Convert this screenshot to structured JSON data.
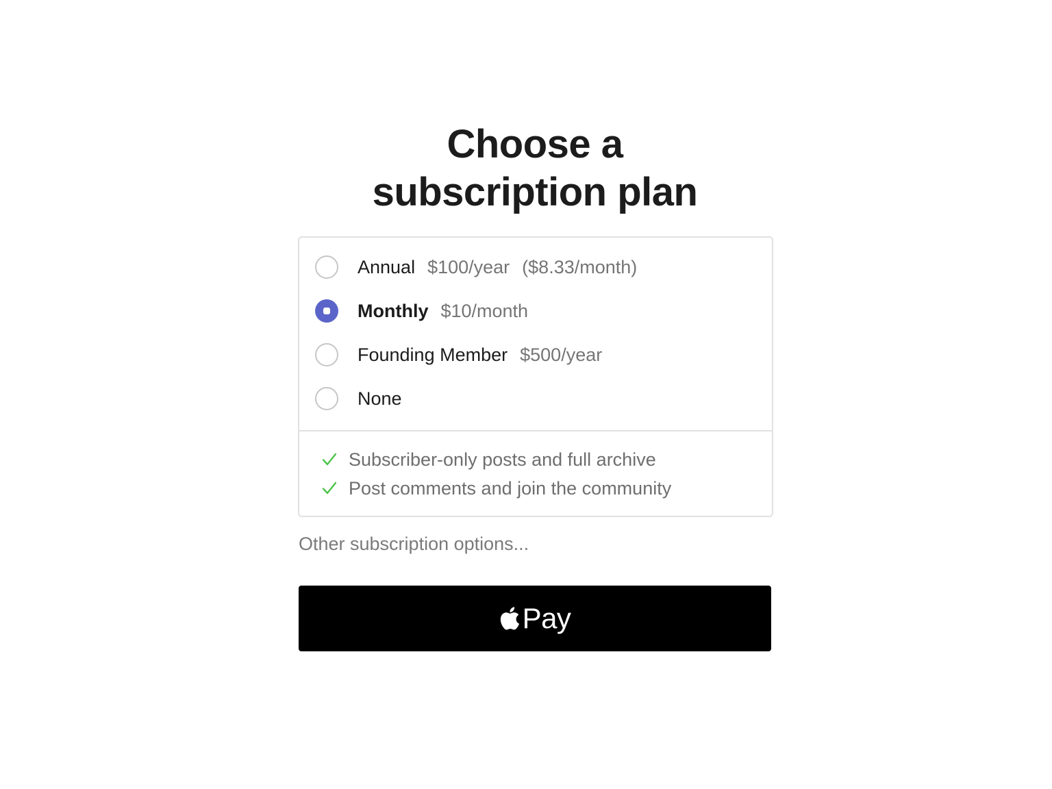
{
  "title": {
    "line1": "Choose a",
    "line2": "subscription plan"
  },
  "plans": [
    {
      "name": "Annual",
      "price": "$100/year",
      "extra": "($8.33/month)",
      "selected": false
    },
    {
      "name": "Monthly",
      "price": "$10/month",
      "extra": "",
      "selected": true
    },
    {
      "name": "Founding Member",
      "price": "$500/year",
      "extra": "",
      "selected": false
    },
    {
      "name": "None",
      "price": "",
      "extra": "",
      "selected": false
    }
  ],
  "benefits": [
    {
      "icon": "checkmark-icon",
      "text": "Subscriber-only posts and full archive"
    },
    {
      "icon": "checkmark-icon",
      "text": "Post comments and join the community"
    }
  ],
  "other_options_link": "Other subscription options...",
  "apple_pay": {
    "icon": "apple-logo-icon",
    "label": "Pay"
  },
  "colors": {
    "accent": "#5b65c9",
    "check": "#4cc34a",
    "button_bg": "#000000"
  }
}
